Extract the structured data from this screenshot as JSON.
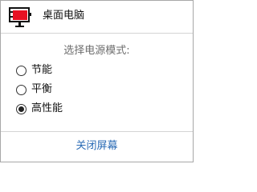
{
  "header": {
    "title": "桌面电脑",
    "icon": "desktop-power-icon",
    "icon_accent": "#e81123"
  },
  "power": {
    "prompt": "选择电源模式:",
    "options": [
      {
        "label": "节能",
        "selected": false
      },
      {
        "label": "平衡",
        "selected": false
      },
      {
        "label": "高性能",
        "selected": true
      }
    ]
  },
  "footer": {
    "close_label": "关闭屏幕",
    "link_color": "#2a6bb5"
  }
}
